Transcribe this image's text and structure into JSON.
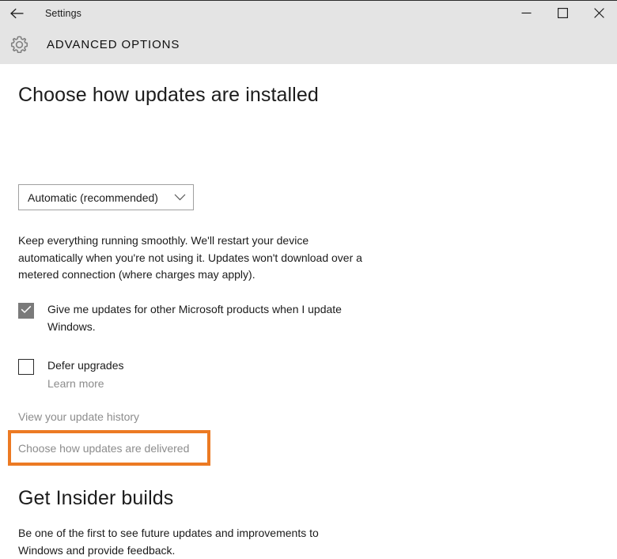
{
  "window": {
    "titlebar": {
      "back_icon": "back-arrow-icon",
      "title": "Settings",
      "minimize_icon": "minimize-icon",
      "maximize_icon": "maximize-icon",
      "close_icon": "close-icon"
    },
    "header": {
      "icon": "gear-icon",
      "title": "ADVANCED OPTIONS"
    }
  },
  "main": {
    "updates_section": {
      "heading": "Choose how updates are installed",
      "select": {
        "value": "Automatic (recommended)",
        "chevron_icon": "chevron-down-icon"
      },
      "description": "Keep everything running smoothly. We'll restart your device automatically when you're not using it. Updates won't download over a metered connection (where charges may apply).",
      "checkboxes": [
        {
          "label": "Give me updates for other Microsoft products when I update Windows.",
          "checked": true,
          "disabled": true,
          "check_icon": "checkmark-icon"
        },
        {
          "label": "Defer upgrades",
          "checked": false,
          "disabled": false,
          "sub_link": "Learn more"
        }
      ],
      "links": [
        {
          "label": "View your update history",
          "highlighted": false
        },
        {
          "label": "Choose how updates are delivered",
          "highlighted": true
        }
      ]
    },
    "insider_section": {
      "heading": "Get Insider builds",
      "description": "Be one of the first to see future updates and improvements to Windows and provide feedback."
    }
  },
  "colors": {
    "chrome_gray": "#e4e4e4",
    "text_primary": "#1b1b1b",
    "link_gray": "#8c8c8c",
    "highlight_orange": "#ec7a23",
    "checkbox_disabled": "#7a7a7a"
  }
}
